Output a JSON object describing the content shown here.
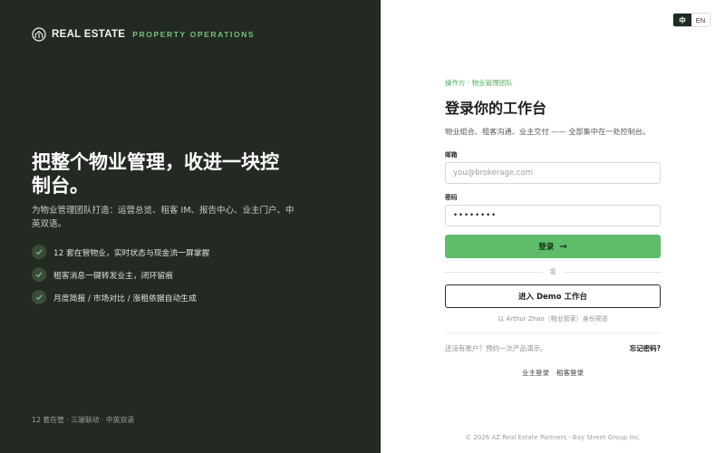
{
  "brand": {
    "name": "REAL ESTATE",
    "subtitle": "PROPERTY OPERATIONS"
  },
  "hero": {
    "title": "把整个物业管理，收进一块控制台。",
    "description": "为物业管理团队打造：运营总览、租客 IM、报告中心、业主门户、中英双语。",
    "features": [
      {
        "text": "12 套在管物业，实时状态与现金流一屏掌握"
      },
      {
        "text": "租客消息一键转发业主，闭环留痕"
      },
      {
        "text": "月度简报 / 市场对比 / 涨租依据自动生成"
      }
    ],
    "footer": "12 套在管 · 三端联动 · 中英双语"
  },
  "language": {
    "zh": "中",
    "en": "EN",
    "active": "zh"
  },
  "login": {
    "eyebrow": "操作方 · 物业管理团队",
    "title": "登录你的工作台",
    "description": "物业组合、租客沟通、业主交付 —— 全部集中在一处控制台。",
    "email_label": "邮箱",
    "email_placeholder": "you@brokerage.com",
    "password_label": "密码",
    "password_value": "••••••••",
    "submit_label": "登录",
    "divider_text": "或",
    "demo_label": "进入 Demo 工作台",
    "demo_note": "以 Arthur Zhao（物业管家）身份预览",
    "signup_text": "还没有账户？预约一次产品演示。",
    "forgot_text": "忘记密码?",
    "owner_login": "业主登录",
    "tenant_login": "租客登录"
  },
  "footer": {
    "copyright": "© 2026 AZ Real Estate Partners · Bay Street Group Inc."
  },
  "colors": {
    "left_bg": "#232a22",
    "accent": "#5fbd6a",
    "accent_text": "#78c07f"
  }
}
